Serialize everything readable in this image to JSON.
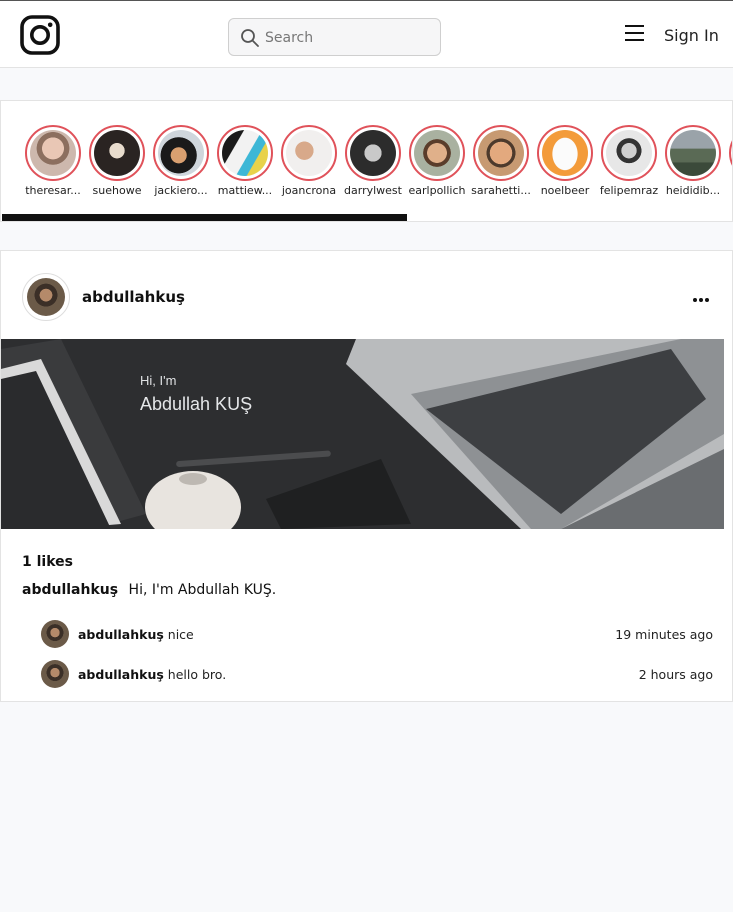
{
  "header": {
    "logo_icon": "instagram-logo-icon",
    "search_placeholder": "Search",
    "menu_icon": "hamburger-menu-icon",
    "signin_label": "Sign In"
  },
  "stories": [
    {
      "username": "theresar..."
    },
    {
      "username": "suehowe"
    },
    {
      "username": "jackiero..."
    },
    {
      "username": "mattiew..."
    },
    {
      "username": "joancrona"
    },
    {
      "username": "darrylwest"
    },
    {
      "username": "earlpollich"
    },
    {
      "username": "sarahetti..."
    },
    {
      "username": "noelbeer"
    },
    {
      "username": "felipemraz"
    },
    {
      "username": "heididib..."
    }
  ],
  "post": {
    "username": "abdullahkuş",
    "more_icon": "more-horizontal-icon",
    "image_text_greeting": "Hi, I'm",
    "image_text_name": "Abdullah KUŞ",
    "likes": "1 likes",
    "caption_user": "abdullahkuş",
    "caption_text": "Hi, I'm Abdullah KUŞ.",
    "comments": [
      {
        "user": "abdullahkuş",
        "text": "nice",
        "time": "19 minutes ago"
      },
      {
        "user": "abdullahkuş",
        "text": "hello bro.",
        "time": "2 hours ago"
      }
    ]
  },
  "colors": {
    "story_ring": "#e0525a",
    "background": "#f8f9fb"
  }
}
